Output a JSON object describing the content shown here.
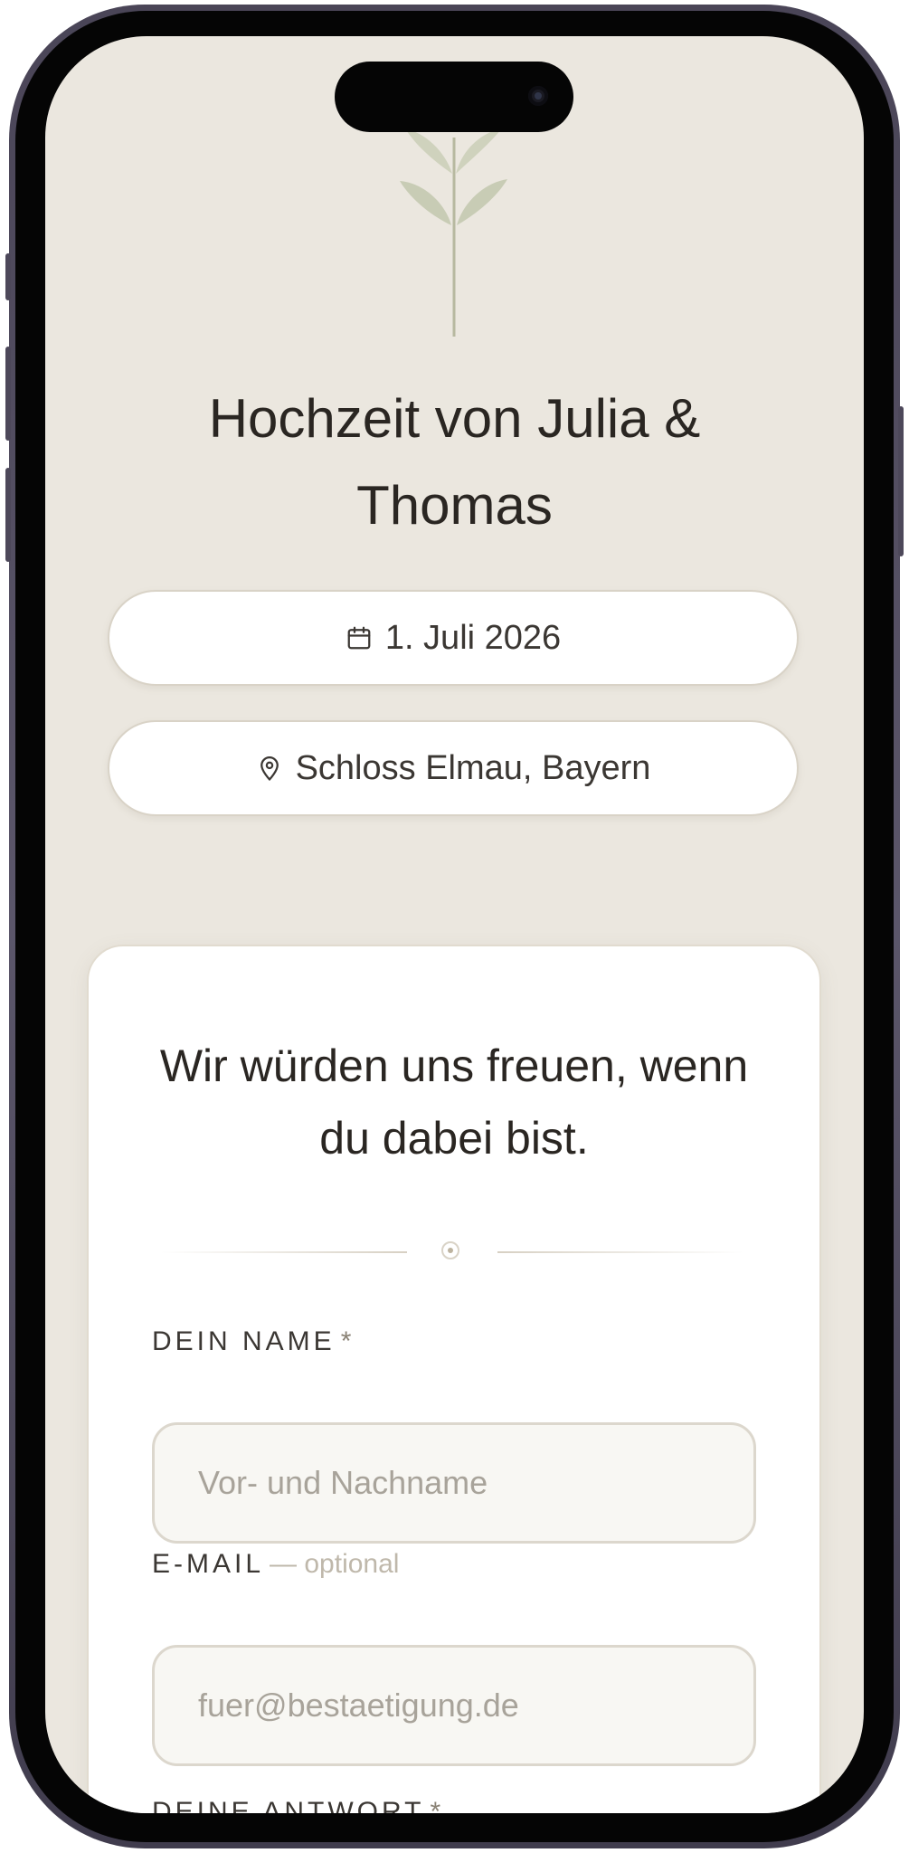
{
  "event": {
    "title_line1": "Hochzeit von Julia &",
    "title_line2": "Thomas",
    "date": "1. Juli 2026",
    "date_icon": "calendar-icon",
    "location": "Schloss Elmau, Bayern",
    "location_icon": "map-pin-icon"
  },
  "rsvp": {
    "heading_line1": "Wir würden uns freuen, wenn",
    "heading_line2": "du dabei bist.",
    "name": {
      "label": "DEIN NAME",
      "required_mark": "*",
      "placeholder": "Vor- und Nachname",
      "value": ""
    },
    "email": {
      "label": "E-MAIL",
      "optional_note": "— optional",
      "placeholder": "fuer@bestaetigung.de",
      "value": ""
    },
    "answer": {
      "label": "DEINE ANTWORT",
      "required_mark": "*"
    }
  },
  "colors": {
    "page_background": "#ebe7df",
    "card_background": "#ffffff",
    "accent_sage": "#c8ccb5",
    "text_dark": "#2a2622"
  }
}
